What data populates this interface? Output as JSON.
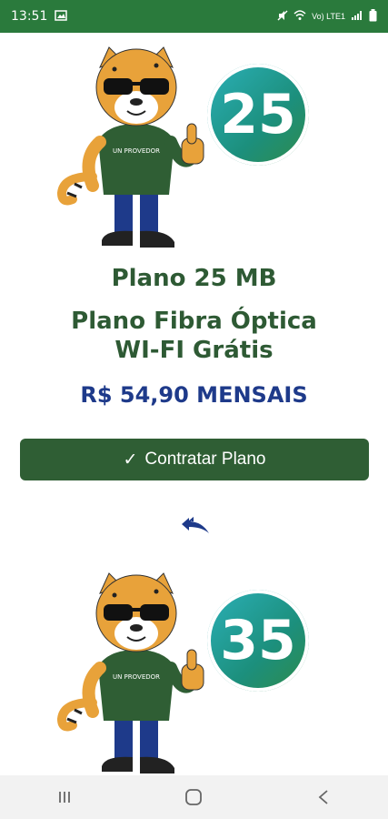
{
  "status_bar": {
    "time": "13:51",
    "network_label": "Vo) LTE1"
  },
  "plans": [
    {
      "badge": "25",
      "title": "Plano 25 MB",
      "subtitle_line1": "Plano Fibra Óptica",
      "subtitle_line2": "WI-FI Grátis",
      "price": "R$ 54,90 MENSAIS",
      "button_label": "Contratar Plano",
      "shirt_logo": "UN PROVEDOR"
    },
    {
      "badge": "35",
      "shirt_logo": "UN PROVEDOR"
    }
  ],
  "nav": {
    "recent_icon": "recent-apps-icon",
    "home_icon": "home-icon",
    "back_icon": "back-icon"
  }
}
